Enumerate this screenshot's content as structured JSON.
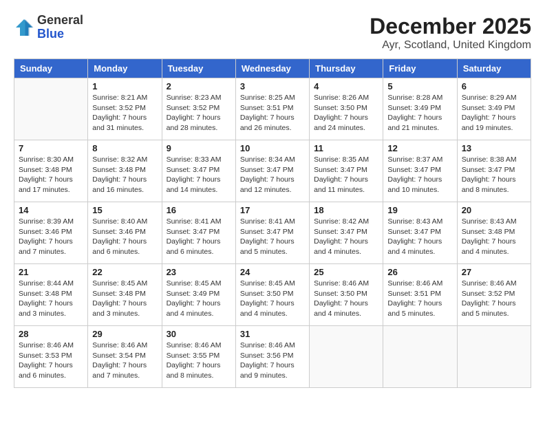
{
  "header": {
    "logo_line1": "General",
    "logo_line2": "Blue",
    "month": "December 2025",
    "location": "Ayr, Scotland, United Kingdom"
  },
  "days_of_week": [
    "Sunday",
    "Monday",
    "Tuesday",
    "Wednesday",
    "Thursday",
    "Friday",
    "Saturday"
  ],
  "weeks": [
    [
      {
        "day": "",
        "info": ""
      },
      {
        "day": "1",
        "info": "Sunrise: 8:21 AM\nSunset: 3:52 PM\nDaylight: 7 hours\nand 31 minutes."
      },
      {
        "day": "2",
        "info": "Sunrise: 8:23 AM\nSunset: 3:52 PM\nDaylight: 7 hours\nand 28 minutes."
      },
      {
        "day": "3",
        "info": "Sunrise: 8:25 AM\nSunset: 3:51 PM\nDaylight: 7 hours\nand 26 minutes."
      },
      {
        "day": "4",
        "info": "Sunrise: 8:26 AM\nSunset: 3:50 PM\nDaylight: 7 hours\nand 24 minutes."
      },
      {
        "day": "5",
        "info": "Sunrise: 8:28 AM\nSunset: 3:49 PM\nDaylight: 7 hours\nand 21 minutes."
      },
      {
        "day": "6",
        "info": "Sunrise: 8:29 AM\nSunset: 3:49 PM\nDaylight: 7 hours\nand 19 minutes."
      }
    ],
    [
      {
        "day": "7",
        "info": "Sunrise: 8:30 AM\nSunset: 3:48 PM\nDaylight: 7 hours\nand 17 minutes."
      },
      {
        "day": "8",
        "info": "Sunrise: 8:32 AM\nSunset: 3:48 PM\nDaylight: 7 hours\nand 16 minutes."
      },
      {
        "day": "9",
        "info": "Sunrise: 8:33 AM\nSunset: 3:47 PM\nDaylight: 7 hours\nand 14 minutes."
      },
      {
        "day": "10",
        "info": "Sunrise: 8:34 AM\nSunset: 3:47 PM\nDaylight: 7 hours\nand 12 minutes."
      },
      {
        "day": "11",
        "info": "Sunrise: 8:35 AM\nSunset: 3:47 PM\nDaylight: 7 hours\nand 11 minutes."
      },
      {
        "day": "12",
        "info": "Sunrise: 8:37 AM\nSunset: 3:47 PM\nDaylight: 7 hours\nand 10 minutes."
      },
      {
        "day": "13",
        "info": "Sunrise: 8:38 AM\nSunset: 3:47 PM\nDaylight: 7 hours\nand 8 minutes."
      }
    ],
    [
      {
        "day": "14",
        "info": "Sunrise: 8:39 AM\nSunset: 3:46 PM\nDaylight: 7 hours\nand 7 minutes."
      },
      {
        "day": "15",
        "info": "Sunrise: 8:40 AM\nSunset: 3:46 PM\nDaylight: 7 hours\nand 6 minutes."
      },
      {
        "day": "16",
        "info": "Sunrise: 8:41 AM\nSunset: 3:47 PM\nDaylight: 7 hours\nand 6 minutes."
      },
      {
        "day": "17",
        "info": "Sunrise: 8:41 AM\nSunset: 3:47 PM\nDaylight: 7 hours\nand 5 minutes."
      },
      {
        "day": "18",
        "info": "Sunrise: 8:42 AM\nSunset: 3:47 PM\nDaylight: 7 hours\nand 4 minutes."
      },
      {
        "day": "19",
        "info": "Sunrise: 8:43 AM\nSunset: 3:47 PM\nDaylight: 7 hours\nand 4 minutes."
      },
      {
        "day": "20",
        "info": "Sunrise: 8:43 AM\nSunset: 3:48 PM\nDaylight: 7 hours\nand 4 minutes."
      }
    ],
    [
      {
        "day": "21",
        "info": "Sunrise: 8:44 AM\nSunset: 3:48 PM\nDaylight: 7 hours\nand 3 minutes."
      },
      {
        "day": "22",
        "info": "Sunrise: 8:45 AM\nSunset: 3:48 PM\nDaylight: 7 hours\nand 3 minutes."
      },
      {
        "day": "23",
        "info": "Sunrise: 8:45 AM\nSunset: 3:49 PM\nDaylight: 7 hours\nand 4 minutes."
      },
      {
        "day": "24",
        "info": "Sunrise: 8:45 AM\nSunset: 3:50 PM\nDaylight: 7 hours\nand 4 minutes."
      },
      {
        "day": "25",
        "info": "Sunrise: 8:46 AM\nSunset: 3:50 PM\nDaylight: 7 hours\nand 4 minutes."
      },
      {
        "day": "26",
        "info": "Sunrise: 8:46 AM\nSunset: 3:51 PM\nDaylight: 7 hours\nand 5 minutes."
      },
      {
        "day": "27",
        "info": "Sunrise: 8:46 AM\nSunset: 3:52 PM\nDaylight: 7 hours\nand 5 minutes."
      }
    ],
    [
      {
        "day": "28",
        "info": "Sunrise: 8:46 AM\nSunset: 3:53 PM\nDaylight: 7 hours\nand 6 minutes."
      },
      {
        "day": "29",
        "info": "Sunrise: 8:46 AM\nSunset: 3:54 PM\nDaylight: 7 hours\nand 7 minutes."
      },
      {
        "day": "30",
        "info": "Sunrise: 8:46 AM\nSunset: 3:55 PM\nDaylight: 7 hours\nand 8 minutes."
      },
      {
        "day": "31",
        "info": "Sunrise: 8:46 AM\nSunset: 3:56 PM\nDaylight: 7 hours\nand 9 minutes."
      },
      {
        "day": "",
        "info": ""
      },
      {
        "day": "",
        "info": ""
      },
      {
        "day": "",
        "info": ""
      }
    ]
  ]
}
